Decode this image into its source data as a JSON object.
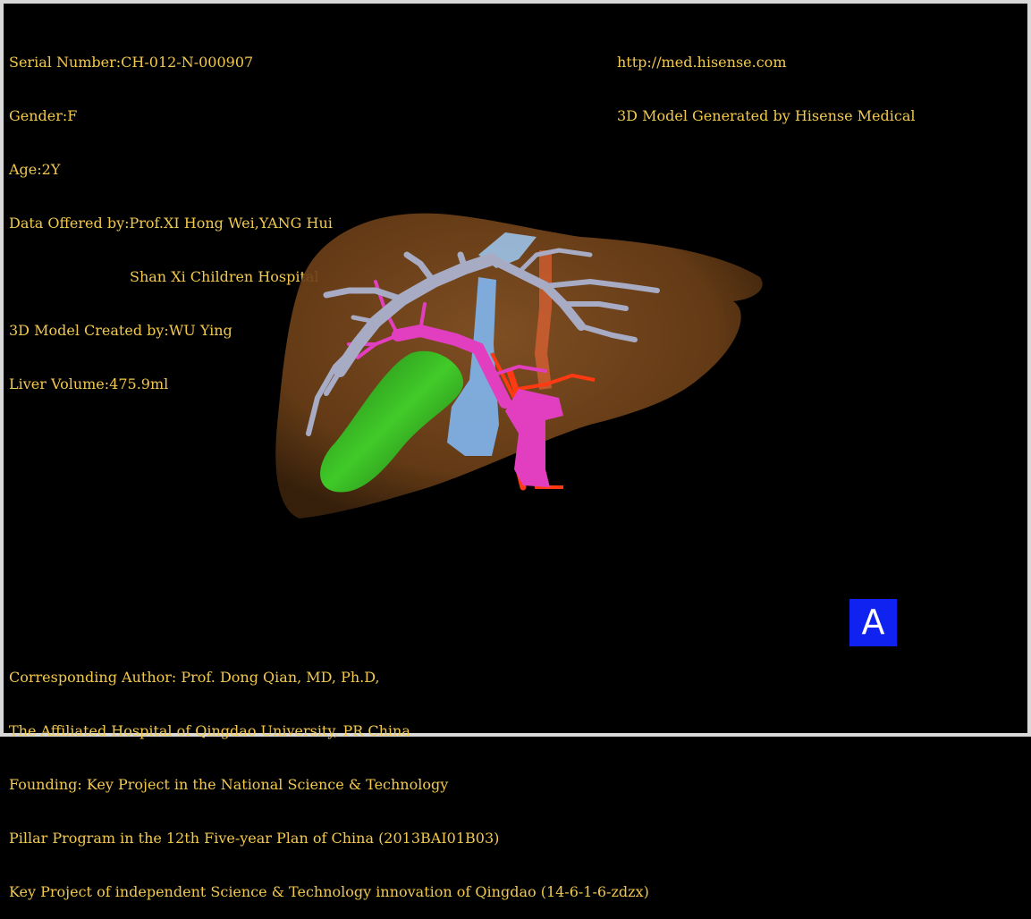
{
  "header_left": {
    "serial": "Serial Number:CH-012-N-000907",
    "gender": "Gender:F",
    "age": "Age:2Y",
    "data_offered_1": "Data Offered by:Prof.XI Hong Wei,YANG Hui",
    "data_offered_2": "Shan Xi Children Hospital",
    "model_created": "3D Model Created by:WU Ying",
    "liver_volume": "Liver Volume:475.9ml"
  },
  "header_right": {
    "url": "http://med.hisense.com",
    "generated_by": "3D Model Generated by Hisense Medical"
  },
  "footer": {
    "line1": "Corresponding Author: Prof. Dong Qian, MD, Ph.D,",
    "line2": "The Affiliated Hospital of Qingdao University, PR China",
    "line3": "Founding: Key Project in the National Science & Technology",
    "line4": "Pillar Program in the 12th Five-year Plan of China (2013BAI01B03)",
    "line5": "Key Project of independent Science & Technology innovation of Qingdao (14-6-1-6-zdzx)"
  },
  "view_badge": "A",
  "colors": {
    "text": "#f2c94c",
    "liver": "#7a4a1e",
    "portal_vein": "#a7abc4",
    "hepatic_vein": "#e23fc0",
    "gallbladder": "#2fae1c",
    "vena_cava": "#7fb6f0",
    "artery": "#ff3a12",
    "badge": "#1022f0"
  }
}
